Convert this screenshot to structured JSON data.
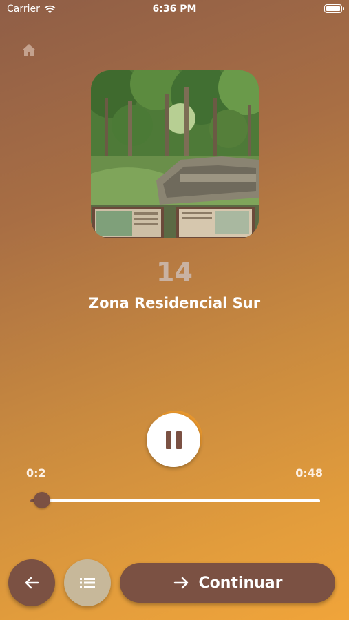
{
  "status_bar": {
    "carrier": "Carrier",
    "time": "6:36 PM"
  },
  "stop": {
    "number": "14",
    "title": "Zona Residencial Sur"
  },
  "player": {
    "elapsed": "0:2",
    "total": "0:48",
    "progress_fraction": 0.04,
    "state": "playing"
  },
  "actions": {
    "continue_label": "Continuar"
  },
  "colors": {
    "primary": "#7b5143",
    "secondary": "#c7b89a",
    "accent_orange": "#e8972e",
    "stop_number": "#c9b2a2"
  },
  "icons": {
    "home": "home-icon",
    "pause": "pause-icon",
    "back": "arrow-left-icon",
    "list": "list-icon",
    "continue": "arrow-right-icon"
  }
}
